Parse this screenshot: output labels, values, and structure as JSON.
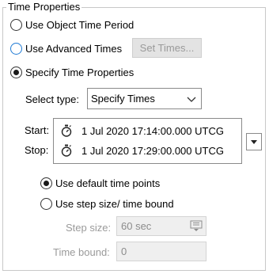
{
  "group": {
    "title": "Time Properties"
  },
  "options": {
    "object_time_period": {
      "label": "Use Object Time Period",
      "selected": false
    },
    "advanced_times": {
      "label": "Use Advanced Times",
      "selected": false
    },
    "specify_properties": {
      "label": "Specify Time Properties",
      "selected": true
    }
  },
  "set_times_button": {
    "label": "Set Times..."
  },
  "select_type": {
    "label": "Select type:",
    "value": "Specify Times"
  },
  "times": {
    "start_label": "Start:",
    "stop_label": "Stop:",
    "start_value": "1 Jul 2020 17:14:00.000 UTCG",
    "stop_value": "1 Jul 2020 17:29:00.000 UTCG"
  },
  "time_points": {
    "default_label": "Use default time points",
    "default_selected": true,
    "step_label": "Use step size/ time bound",
    "step_selected": false
  },
  "step_size": {
    "label": "Step size:",
    "value": "60 sec"
  },
  "time_bound": {
    "label": "Time bound:",
    "value": "0"
  },
  "colors": {
    "focus_ring": "#1f7ad4",
    "disabled_text": "#9a9a9a",
    "disabled_fill": "#efefef"
  },
  "icons": {
    "stopwatch": "stopwatch-icon",
    "chevron": "chevron-down-icon",
    "dropdown_arrow": "dropdown-arrow-icon",
    "spin": "keypad-spinner-icon"
  }
}
